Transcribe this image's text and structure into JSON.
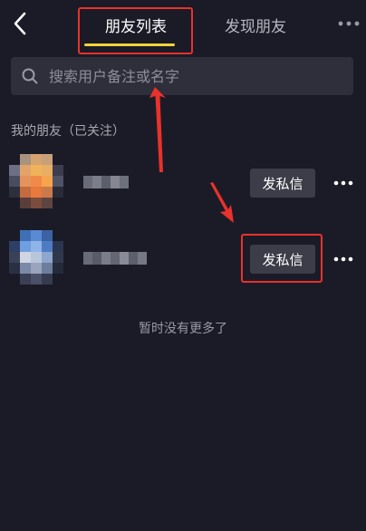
{
  "header": {
    "tabs": [
      {
        "label": "朋友列表",
        "active": true
      },
      {
        "label": "发现朋友",
        "active": false
      }
    ],
    "back_icon": "chevron-left-icon",
    "more_icon": "more-horizontal-icon"
  },
  "search": {
    "placeholder": "搜索用户备注或名字",
    "value": ""
  },
  "section": {
    "title": "我的朋友（已关注）"
  },
  "friends": [
    {
      "dm_label": "发私信",
      "avatar": "pixelated",
      "name": "pixelated"
    },
    {
      "dm_label": "发私信",
      "avatar": "pixelated",
      "name": "pixelated"
    }
  ],
  "empty_hint": "暂时没有更多了",
  "colors": {
    "background": "#1b1b27",
    "tab_underline": "#f1d23c",
    "annotation": "#e8322b",
    "button_bg": "#3c3d48",
    "search_bg": "#2e2f3b"
  }
}
